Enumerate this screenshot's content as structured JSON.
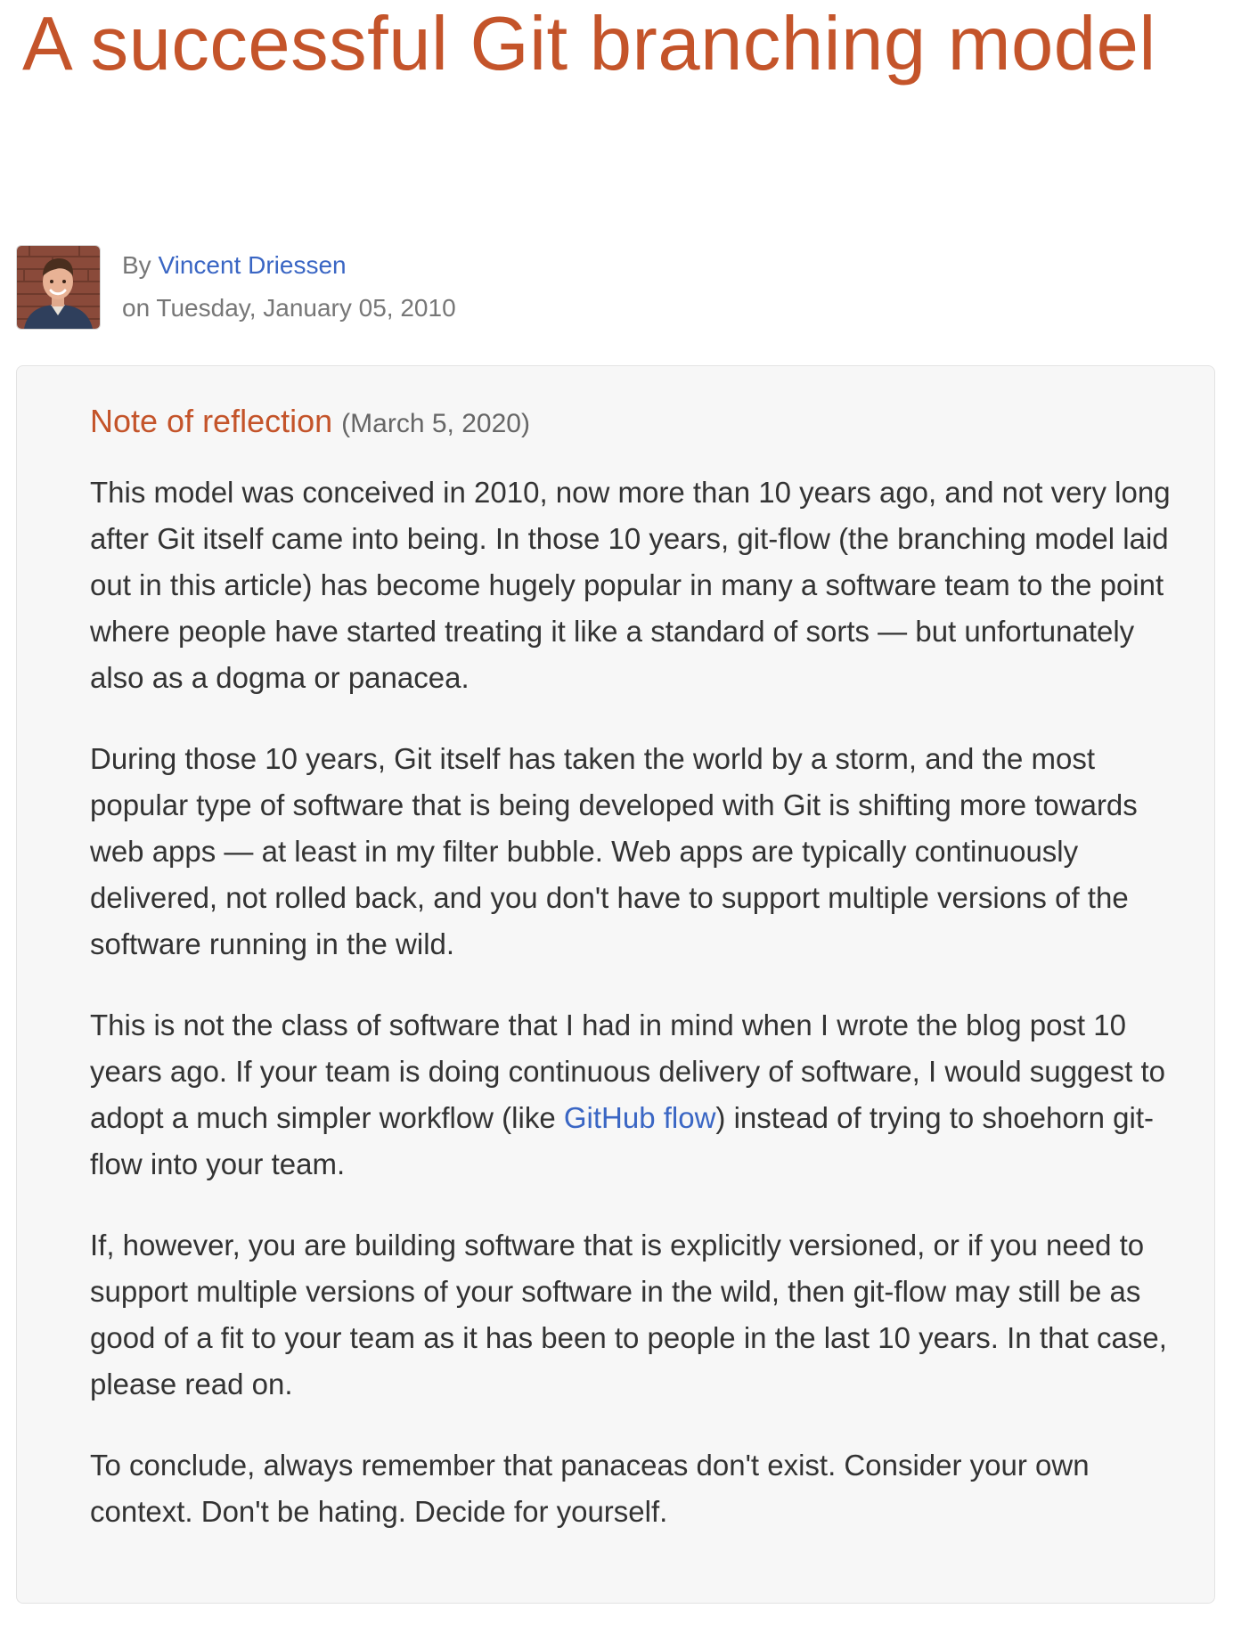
{
  "article": {
    "title": "A successful Git branching model",
    "byline": {
      "by_prefix": "By",
      "author": "Vincent Driessen",
      "date_line": "on Tuesday, January 05, 2010"
    }
  },
  "note": {
    "heading": "Note of reflection",
    "heading_date": "(March 5, 2020)",
    "p1": "This model was conceived in 2010, now more than 10 years ago, and not very long after Git itself came into being. In those 10 years, git-flow (the branching model laid out in this article) has become hugely popular in many a software team to the point where people have started treating it like a standard of sorts — but unfortunately also as a dogma or panacea.",
    "p2": "During those 10 years, Git itself has taken the world by a storm, and the most popular type of software that is being developed with Git is shifting more towards web apps — at least in my filter bubble. Web apps are typically continuously delivered, not rolled back, and you don't have to support multiple versions of the software running in the wild.",
    "p3_before": "This is not the class of software that I had in mind when I wrote the blog post 10 years ago. If your team is doing continuous delivery of software, I would suggest to adopt a much simpler workflow (like ",
    "p3_link": "GitHub flow",
    "p3_after": ") instead of trying to shoehorn git-flow into your team.",
    "p4": "If, however, you are building software that is explicitly versioned, or if you need to support multiple versions of your software in the wild, then git-flow may still be as good of a fit to your team as it has been to people in the last 10 years. In that case, please read on.",
    "p5": "To conclude, always remember that panaceas don't exist. Consider your own context. Don't be hating. Decide for yourself."
  },
  "colors": {
    "title": "#c4542a",
    "link": "#3a66c4",
    "note_background": "#f7f7f7"
  }
}
